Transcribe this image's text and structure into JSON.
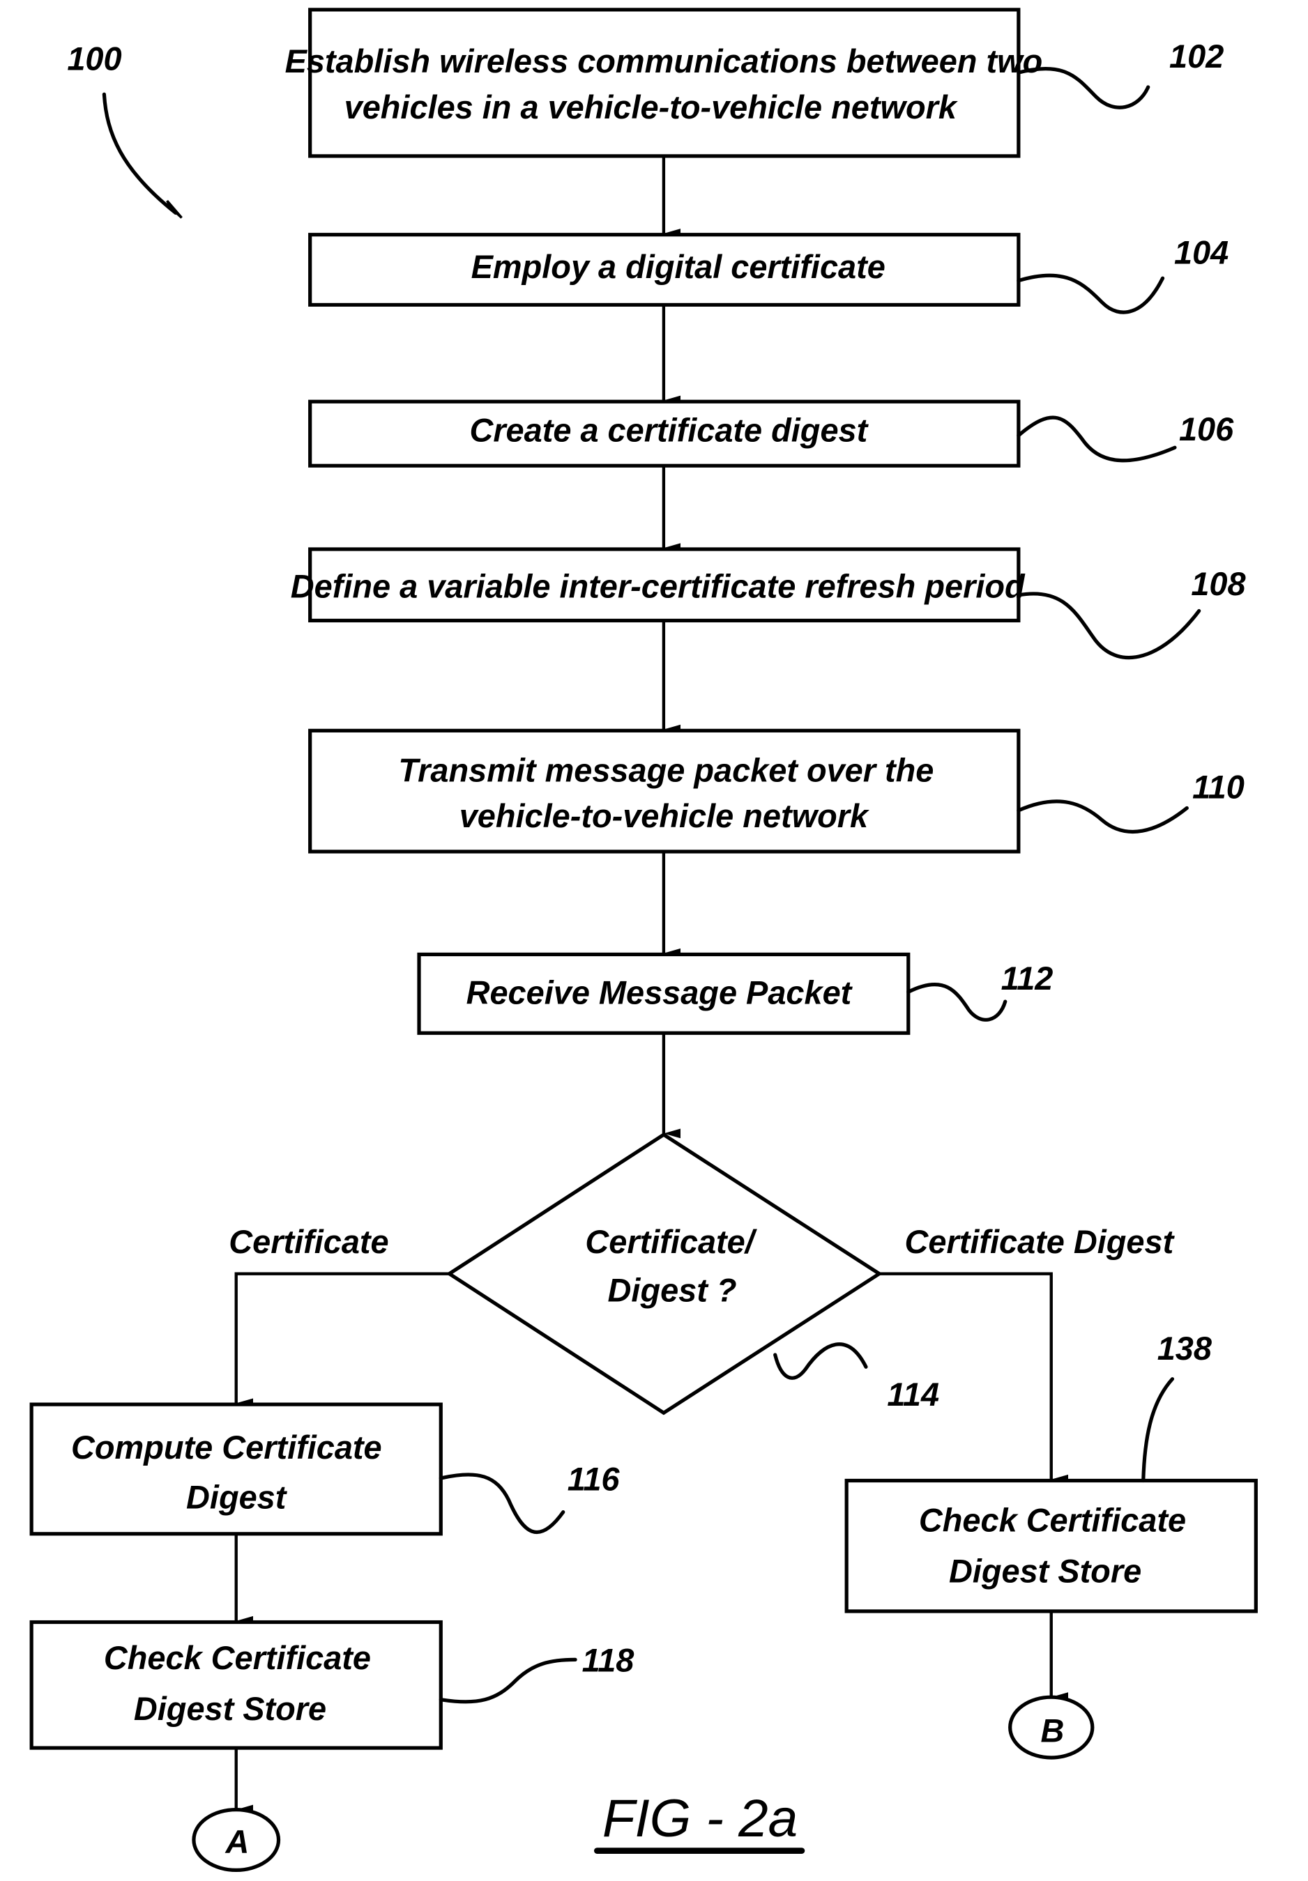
{
  "diagram": {
    "figure_label": "FIG - 2a",
    "reference": "100",
    "steps": [
      {
        "id": "102",
        "lines": [
          "Establish wireless communications between two",
          "vehicles in a vehicle-to-vehicle network"
        ]
      },
      {
        "id": "104",
        "lines": [
          "Employ a digital certificate"
        ]
      },
      {
        "id": "106",
        "lines": [
          "Create a certificate digest"
        ]
      },
      {
        "id": "108",
        "lines": [
          "Define a variable inter-certificate refresh period"
        ]
      },
      {
        "id": "110",
        "lines": [
          "Transmit message packet over the",
          "vehicle-to-vehicle network"
        ]
      },
      {
        "id": "112",
        "lines": [
          "Receive Message Packet"
        ]
      }
    ],
    "decision": {
      "id": "114",
      "lines": [
        "Certificate/",
        "Digest ?"
      ],
      "left_label": "Certificate",
      "right_label": "Certificate Digest"
    },
    "left_branch": [
      {
        "id": "116",
        "lines": [
          "Compute Certificate",
          "Digest"
        ]
      },
      {
        "id": "118",
        "lines": [
          "Check Certificate",
          "Digest Store"
        ]
      }
    ],
    "right_branch": [
      {
        "id": "138",
        "lines": [
          "Check Certificate",
          "Digest Store"
        ]
      }
    ],
    "connectors": {
      "left": "A",
      "right": "B"
    }
  }
}
